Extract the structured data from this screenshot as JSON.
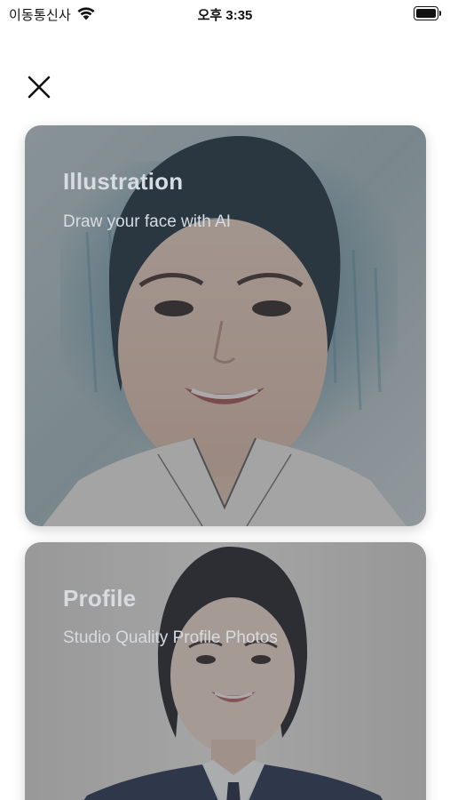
{
  "status_bar": {
    "carrier": "이동통신사",
    "time": "오후 3:35",
    "wifi_icon": "wifi-icon",
    "battery_icon": "battery-icon"
  },
  "close_icon": "close-icon",
  "cards": [
    {
      "title": "Illustration",
      "subtitle": "Draw your face with AI"
    },
    {
      "title": "Profile",
      "subtitle": "Studio Quality Profile Photos"
    }
  ],
  "colors": {
    "overlay": "#464a52",
    "card_text": "#d7dbe2",
    "illustration_accent": "#2f6f86",
    "profile_suit": "#1f2a45"
  }
}
